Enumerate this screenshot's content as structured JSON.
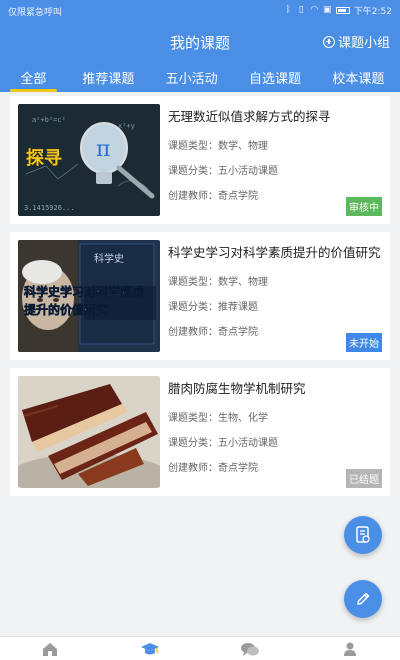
{
  "status_bar": {
    "left_text": "仅限紧急呼叫",
    "time": "下午2:52"
  },
  "header": {
    "title": "我的课题",
    "group_button": "课题小组"
  },
  "tabs": [
    {
      "label": "全部",
      "active": true
    },
    {
      "label": "推荐课题",
      "active": false
    },
    {
      "label": "五小活动",
      "active": false
    },
    {
      "label": "自选课题",
      "active": false
    },
    {
      "label": "校本课题",
      "active": false
    }
  ],
  "topics": [
    {
      "title": "无理数近似值求解方式的探寻",
      "type_label": "课题类型：数学、物理",
      "category_label": "课题分类：五小活动课题",
      "teacher_label": "创建教师：奇点学院",
      "status": "审核中",
      "status_color": "#5cb85c",
      "thumb_icon": "lightbulb-math-image"
    },
    {
      "title": "科学史学习对科学素质提升的价值研究",
      "type_label": "课题类型：数学、物理",
      "category_label": "课题分类：推荐课题",
      "teacher_label": "创建教师：奇点学院",
      "status": "未开始",
      "status_color": "#3f88e5",
      "thumb_icon": "scientist-portrait-image"
    },
    {
      "title": "腊肉防腐生物学机制研究",
      "type_label": "课题类型：生物、化学",
      "category_label": "课题分类：五小活动课题",
      "teacher_label": "创建教师：奇点学院",
      "status": "已结题",
      "status_color": "#b5b5b5",
      "thumb_icon": "cured-meat-image"
    }
  ],
  "thumb_text": {
    "explore": "探寻",
    "pi": "π",
    "pi_value": "3.1415926...",
    "formula1": "a²+b²=c²",
    "formula2": "x²+y",
    "overlay_line1": "科学史学习对科学素质",
    "overlay_line2": "提升的价值研究",
    "book_title": "科学史"
  },
  "fabs": [
    "document-icon",
    "pencil-icon"
  ],
  "bottom_nav": [
    "home-icon",
    "graduation-cap-icon",
    "chat-bubbles-icon",
    "user-icon"
  ],
  "colors": {
    "primary": "#4a8ee6",
    "tab_indicator": "#f5c518",
    "active_nav": "#4a8ee6",
    "inactive_nav": "#9a9a9a"
  }
}
